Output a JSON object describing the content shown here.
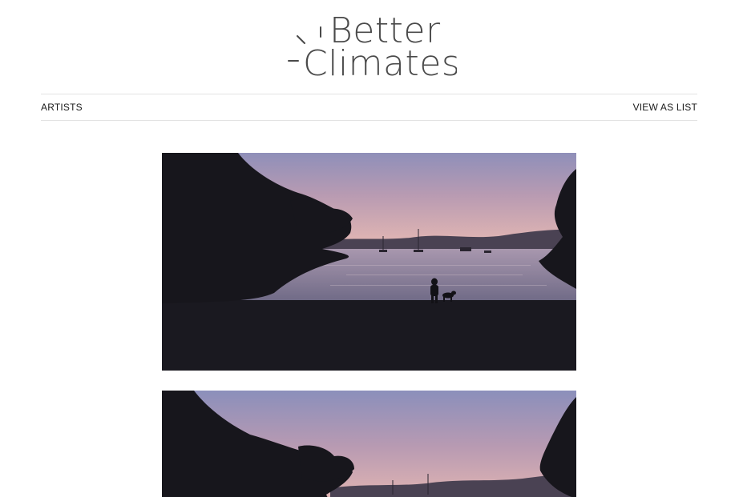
{
  "logo": {
    "line1": "Better",
    "line2": "Climates"
  },
  "nav": {
    "left_label": "ARTISTS",
    "right_label": "VIEW AS LIST"
  },
  "gallery": {
    "photos": [
      {
        "subject": "sunset-bay-with-figure-and-dog"
      },
      {
        "subject": "sunset-bay-with-trees"
      }
    ]
  },
  "colors": {
    "sky_top": "#8a8fb8",
    "sky_mid": "#b79ab2",
    "sky_horizon": "#e2b7b4",
    "silhouette": "#17161c",
    "water": "#8f86a4"
  }
}
